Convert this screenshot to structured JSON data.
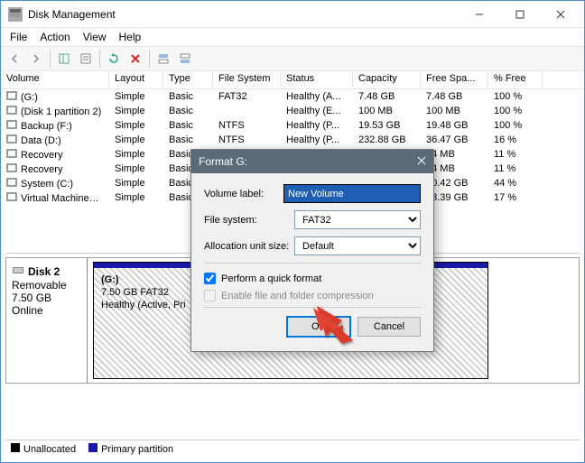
{
  "window": {
    "title": "Disk Management"
  },
  "menu": {
    "file": "File",
    "action": "Action",
    "view": "View",
    "help": "Help"
  },
  "columns": [
    "Volume",
    "Layout",
    "Type",
    "File System",
    "Status",
    "Capacity",
    "Free Spa...",
    "% Free"
  ],
  "rows": [
    {
      "vol": "(G:)",
      "layout": "Simple",
      "type": "Basic",
      "fs": "FAT32",
      "status": "Healthy (A...",
      "cap": "7.48 GB",
      "free": "7.48 GB",
      "pct": "100 %"
    },
    {
      "vol": "(Disk 1 partition 2)",
      "layout": "Simple",
      "type": "Basic",
      "fs": "",
      "status": "Healthy (E...",
      "cap": "100 MB",
      "free": "100 MB",
      "pct": "100 %"
    },
    {
      "vol": "Backup (F:)",
      "layout": "Simple",
      "type": "Basic",
      "fs": "NTFS",
      "status": "Healthy (P...",
      "cap": "19.53 GB",
      "free": "19.48 GB",
      "pct": "100 %"
    },
    {
      "vol": "Data (D:)",
      "layout": "Simple",
      "type": "Basic",
      "fs": "NTFS",
      "status": "Healthy (P...",
      "cap": "232.88 GB",
      "free": "36.47 GB",
      "pct": "16 %"
    },
    {
      "vol": "Recovery",
      "layout": "Simple",
      "type": "Basic",
      "fs": "",
      "status": "",
      "cap": "",
      "free": "54 MB",
      "pct": "11 %"
    },
    {
      "vol": "Recovery",
      "layout": "Simple",
      "type": "Basic",
      "fs": "",
      "status": "",
      "cap": "",
      "free": "54 MB",
      "pct": "11 %"
    },
    {
      "vol": "System (C:)",
      "layout": "Simple",
      "type": "Basic",
      "fs": "",
      "status": "",
      "cap": "",
      "free": "60.42 GB",
      "pct": "44 %"
    },
    {
      "vol": "Virtual Machines (...",
      "layout": "Simple",
      "type": "Basic",
      "fs": "",
      "status": "",
      "cap": "",
      "free": "13.39 GB",
      "pct": "17 %"
    }
  ],
  "disk": {
    "name": "Disk 2",
    "kind": "Removable",
    "size": "7.50 GB",
    "state": "Online",
    "partition": {
      "label": "(G:)",
      "line2": "7.50 GB FAT32",
      "line3": "Healthy (Active, Pri"
    }
  },
  "legend": {
    "unallocated": "Unallocated",
    "primary": "Primary partition"
  },
  "dialog": {
    "title": "Format G:",
    "volume_label_lbl": "Volume label:",
    "volume_label_val": "New Volume",
    "file_system_lbl": "File system:",
    "file_system_val": "FAT32",
    "alloc_lbl": "Allocation unit size:",
    "alloc_val": "Default",
    "quick_format": "Perform a quick format",
    "compression": "Enable file and folder compression",
    "ok": "OK",
    "cancel": "Cancel"
  }
}
